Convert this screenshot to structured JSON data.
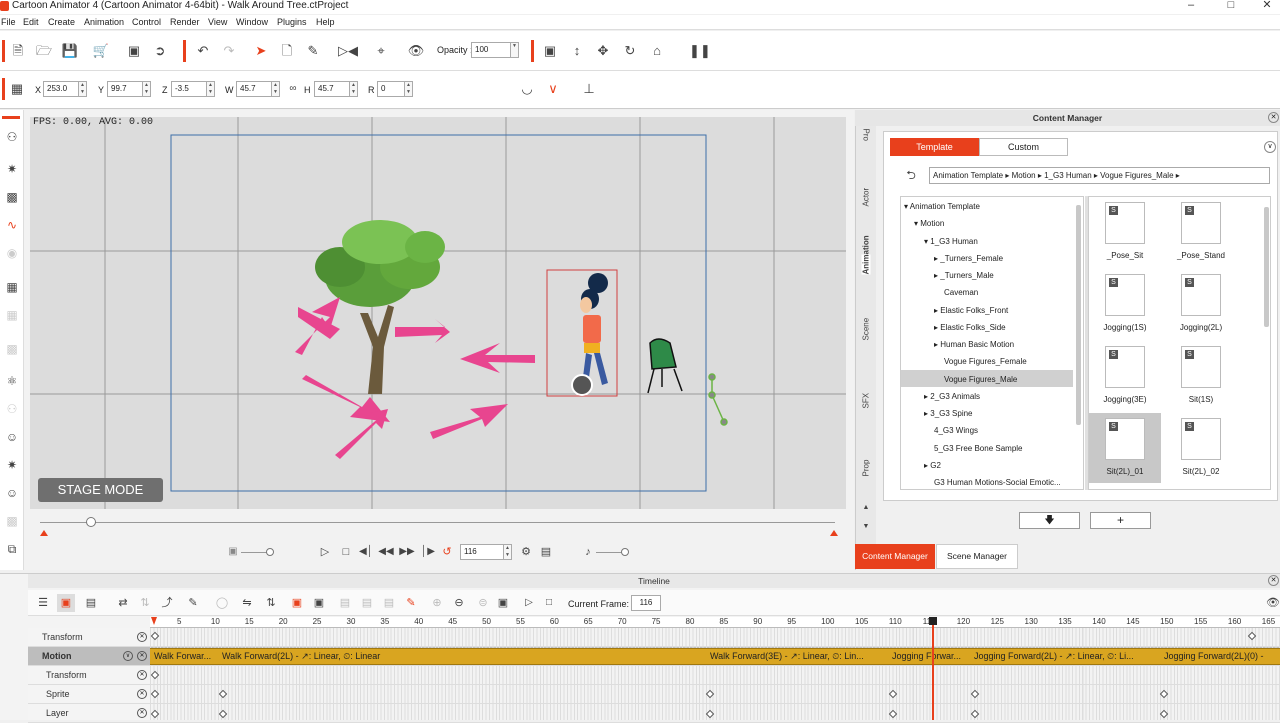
{
  "window": {
    "title": "Cartoon Animator 4  (Cartoon Animator 4-64bit) - Walk Around Tree.ctProject"
  },
  "menu": [
    "File",
    "Edit",
    "Create",
    "Animation",
    "Control",
    "Render",
    "View",
    "Window",
    "Plugins",
    "Help"
  ],
  "toolbar": {
    "opacity_label": "Opacity :",
    "opacity_value": "100"
  },
  "transform": {
    "x_label": "X",
    "x": "253.0",
    "y_label": "Y",
    "y": "99.7",
    "z_label": "Z",
    "z": "-3.5",
    "w_label": "W",
    "w": "45.7",
    "h_label": "H",
    "h": "45.7",
    "r_label": "R",
    "r": "0"
  },
  "stage": {
    "fps": "FPS: 0.00, AVG: 0.00",
    "mode_label": "STAGE MODE"
  },
  "playback": {
    "frame": "116"
  },
  "content_manager": {
    "title": "Content Manager",
    "side_tabs": [
      "Pro",
      "Actor",
      "Animation",
      "Scene",
      "SFX",
      "Prop"
    ],
    "tab_template": "Template",
    "tab_custom": "Custom",
    "breadcrumb": [
      "Animation Template",
      "Motion",
      "1_G3 Human",
      "Vogue Figures_Male"
    ],
    "tree": [
      {
        "label": "Animation Template"
      },
      {
        "label": "Motion"
      },
      {
        "label": "1_G3 Human"
      },
      {
        "label": "_Turners_Female"
      },
      {
        "label": "_Turners_Male"
      },
      {
        "label": "Caveman"
      },
      {
        "label": "Elastic Folks_Front"
      },
      {
        "label": "Elastic Folks_Side"
      },
      {
        "label": "Human Basic Motion"
      },
      {
        "label": "Vogue Figures_Female"
      },
      {
        "label": "Vogue Figures_Male"
      },
      {
        "label": "2_G3 Animals"
      },
      {
        "label": "3_G3 Spine"
      },
      {
        "label": "4_G3 Wings"
      },
      {
        "label": "5_G3 Free Bone Sample"
      },
      {
        "label": "G2"
      },
      {
        "label": "G3 Human Motions-Social Emotic..."
      }
    ],
    "thumbs": [
      "_Pose_Sit",
      "_Pose_Stand",
      "Jogging(1S)",
      "Jogging(2L)",
      "Jogging(3E)",
      "Sit(1S)",
      "Sit(2L)_01",
      "Sit(2L)_02"
    ],
    "thumb_badge": "S",
    "btn_content_manager": "Content Manager",
    "btn_scene_manager": "Scene Manager"
  },
  "timeline": {
    "title": "Timeline",
    "current_frame_label": "Current Frame:",
    "current_frame": "116",
    "ruler": [
      "5",
      "10",
      "15",
      "20",
      "25",
      "30",
      "35",
      "40",
      "45",
      "50",
      "55",
      "60",
      "65",
      "70",
      "75",
      "80",
      "85",
      "90",
      "95",
      "100",
      "105",
      "110",
      "115",
      "120",
      "125",
      "130",
      "135",
      "140",
      "145",
      "150",
      "155",
      "160",
      "165"
    ],
    "tracks": [
      "Transform",
      "Motion",
      "Transform",
      "Sprite",
      "Layer"
    ],
    "motion_segments": [
      "Walk Forwar...",
      "Walk Forward(2L) - ↗: Linear, ⏲: Linear",
      "Walk Forward(3E) - ↗: Linear, ⏲: Lin...",
      "Jogging Forwar...",
      "Jogging Forward(2L) - ↗: Linear, ⏲: Li...",
      "Jogging Forward(2L)(0) -"
    ]
  },
  "colors": {
    "accent": "#e8401c",
    "motion_bar": "#d9a520",
    "selected_thumb": "#c8c8c8"
  }
}
